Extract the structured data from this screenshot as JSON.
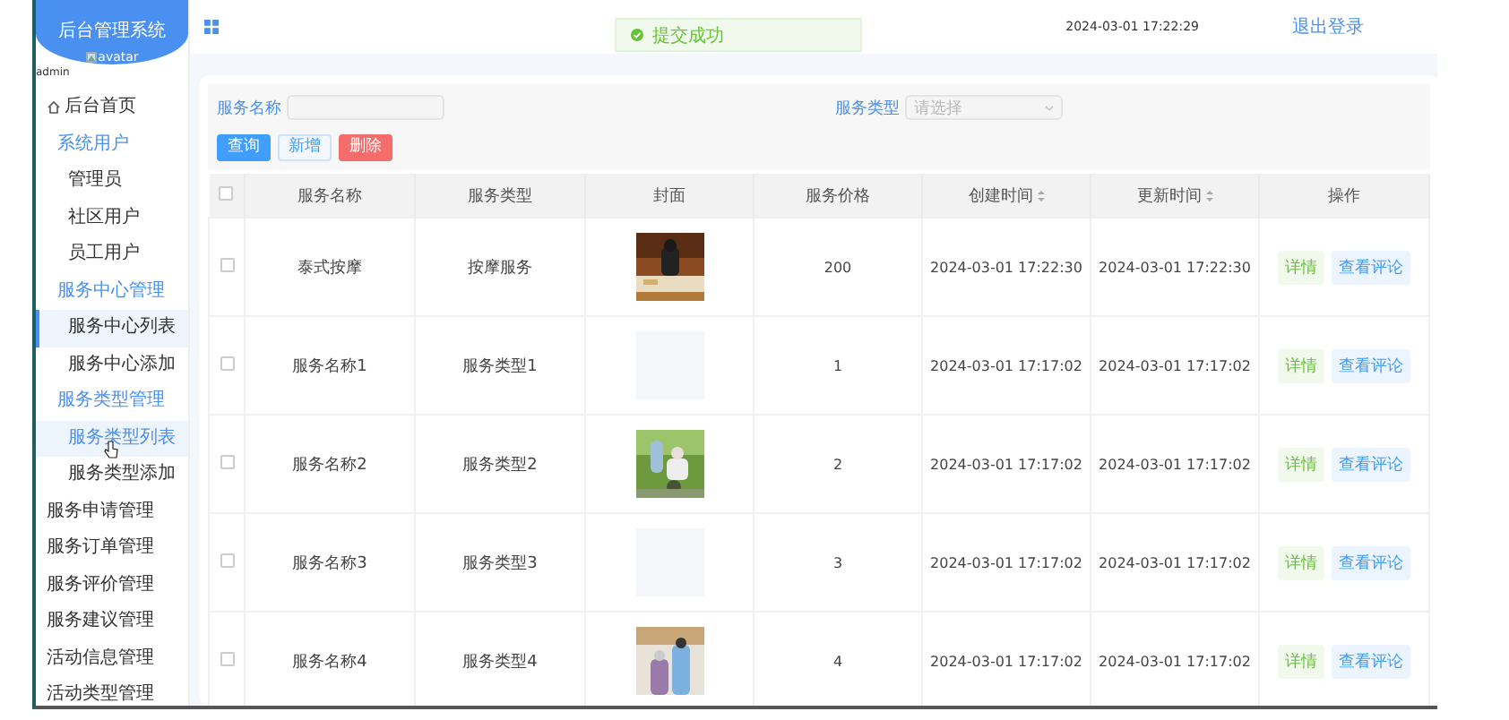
{
  "sidebar": {
    "title": "后台管理系统",
    "avatar_alt": "avatar",
    "user": "admin",
    "items": [
      {
        "label": "后台首页",
        "kind": "home",
        "selected": false,
        "hovered": false
      },
      {
        "label": "系统用户",
        "kind": "group",
        "selected": false,
        "hovered": false,
        "children": [
          {
            "label": "管理员",
            "selected": false,
            "hovered": false
          },
          {
            "label": "社区用户",
            "selected": false,
            "hovered": false
          },
          {
            "label": "员工用户",
            "selected": false,
            "hovered": false
          }
        ]
      },
      {
        "label": "服务中心管理",
        "kind": "group",
        "selected": false,
        "hovered": false,
        "children": [
          {
            "label": "服务中心列表",
            "selected": true,
            "hovered": false
          },
          {
            "label": "服务中心添加",
            "selected": false,
            "hovered": false
          }
        ]
      },
      {
        "label": "服务类型管理",
        "kind": "group",
        "selected": false,
        "hovered": false,
        "children": [
          {
            "label": "服务类型列表",
            "selected": false,
            "hovered": true
          },
          {
            "label": "服务类型添加",
            "selected": false,
            "hovered": false
          }
        ]
      },
      {
        "label": "服务申请管理",
        "kind": "plain",
        "selected": false,
        "hovered": false
      },
      {
        "label": "服务订单管理",
        "kind": "plain",
        "selected": false,
        "hovered": false
      },
      {
        "label": "服务评价管理",
        "kind": "plain",
        "selected": false,
        "hovered": false
      },
      {
        "label": "服务建议管理",
        "kind": "plain",
        "selected": false,
        "hovered": false
      },
      {
        "label": "活动信息管理",
        "kind": "plain",
        "selected": false,
        "hovered": false
      },
      {
        "label": "活动类型管理",
        "kind": "plain",
        "selected": false,
        "hovered": false
      }
    ]
  },
  "topbar": {
    "time": "2024-03-01 17:22:29",
    "logout": "退出登录"
  },
  "toast": {
    "kind": "success",
    "text": "提交成功"
  },
  "search": {
    "fields": [
      {
        "label": "服务名称",
        "kind": "input"
      },
      {
        "label": "服务类型",
        "kind": "select",
        "placeholder": "请选择"
      }
    ],
    "buttons": [
      {
        "label": "查询",
        "kind": "primary"
      },
      {
        "label": "新增",
        "kind": "plain"
      },
      {
        "label": "删除",
        "kind": "danger"
      }
    ]
  },
  "table": {
    "all_checked": false,
    "columns": [
      {
        "label": "服务名称",
        "sortable": false
      },
      {
        "label": "服务类型",
        "sortable": false
      },
      {
        "label": "封面",
        "sortable": false
      },
      {
        "label": "服务价格",
        "sortable": false
      },
      {
        "label": "创建时间",
        "sortable": true
      },
      {
        "label": "更新时间",
        "sortable": true
      },
      {
        "label": "操作",
        "sortable": false
      }
    ],
    "rows": [
      {
        "checked": false,
        "name": "泰式按摩",
        "type": "按摩服务",
        "cover": {
          "kind": "picture"
        },
        "price": "200",
        "created": "2024-03-01 17:22:30",
        "updated": "2024-03-01 17:22:30",
        "actions": [
          "详情",
          "查看评论"
        ]
      },
      {
        "checked": false,
        "name": "服务名称1",
        "type": "服务类型1",
        "cover": {
          "kind": "empty"
        },
        "price": "1",
        "created": "2024-03-01 17:17:02",
        "updated": "2024-03-01 17:17:02",
        "actions": [
          "详情",
          "查看评论"
        ]
      },
      {
        "checked": false,
        "name": "服务名称2",
        "type": "服务类型2",
        "cover": {
          "kind": "picture"
        },
        "price": "2",
        "created": "2024-03-01 17:17:02",
        "updated": "2024-03-01 17:17:02",
        "actions": [
          "详情",
          "查看评论"
        ]
      },
      {
        "checked": false,
        "name": "服务名称3",
        "type": "服务类型3",
        "cover": {
          "kind": "empty"
        },
        "price": "3",
        "created": "2024-03-01 17:17:02",
        "updated": "2024-03-01 17:17:02",
        "actions": [
          "详情",
          "查看评论"
        ]
      },
      {
        "checked": false,
        "name": "服务名称4",
        "type": "服务类型4",
        "cover": {
          "kind": "picture"
        },
        "price": "4",
        "created": "2024-03-01 17:17:02",
        "updated": "2024-03-01 17:17:02",
        "actions": [
          "详情",
          "查看评论"
        ]
      }
    ]
  }
}
